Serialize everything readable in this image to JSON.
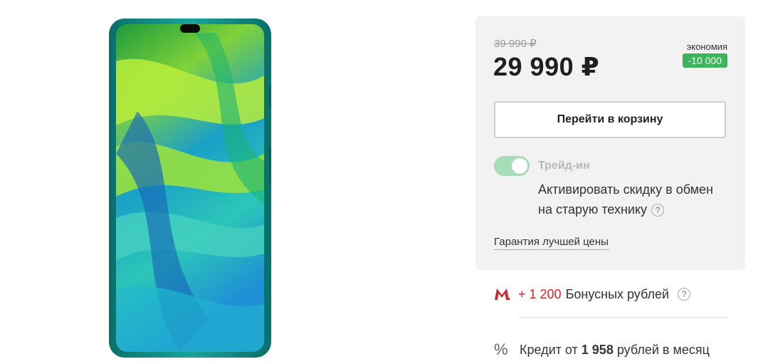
{
  "product": {
    "image_icon": "smartphone-image"
  },
  "pricing": {
    "old_price": "39 990 ₽",
    "price": "29 990 ₽",
    "savings_label": "экономия",
    "savings_value": "-10 000"
  },
  "actions": {
    "cart_button_label": "Перейти в корзину"
  },
  "trade_in": {
    "title": "Трейд-ин",
    "toggle_state": "on",
    "description": "Активировать скидку в обмен на старую технику",
    "help": "?"
  },
  "guarantee_link": "Гарантия лучшей цены",
  "bonus": {
    "logo_icon": "m-logo-icon",
    "amount": "+ 1 200",
    "label": "Бонусных рублей",
    "help": "?"
  },
  "credit": {
    "icon": "percent-icon",
    "prefix": "Кредит от",
    "amount": "1 958",
    "suffix": "рублей в месяц"
  },
  "colors": {
    "accent_green": "#3cb55a",
    "bonus_red": "#d4232b",
    "panel_bg": "#f2f2f2"
  }
}
